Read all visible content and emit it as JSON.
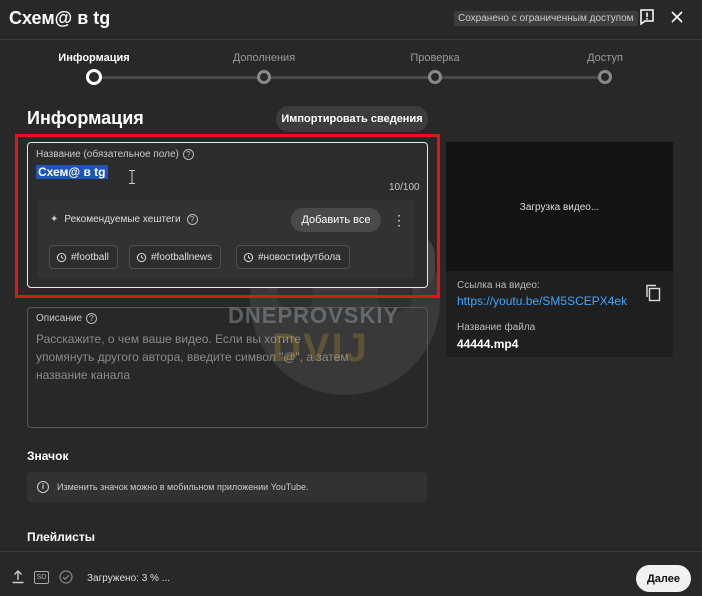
{
  "header": {
    "title": "Схем@ в tg",
    "saved_badge": "Сохранено с ограниченным доступом",
    "feedback_icon": "feedback-icon",
    "close_icon": "close-icon"
  },
  "steps": [
    {
      "label": "Информация",
      "active": true
    },
    {
      "label": "Дополнения",
      "active": false
    },
    {
      "label": "Проверка",
      "active": false
    },
    {
      "label": "Доступ",
      "active": false
    }
  ],
  "section": {
    "title": "Информация",
    "import_button": "Импортировать сведения"
  },
  "title_field": {
    "label": "Название (обязательное поле)",
    "value": "Схем@ в tg",
    "char_count": "10/100"
  },
  "hashtags": {
    "label": "Рекомендуемые хештеги",
    "add_all": "Добавить все",
    "tags": [
      "#football",
      "#footballnews",
      "#новостифутбола"
    ]
  },
  "watermark": {
    "line1": "DNEPROVSKIY",
    "line2": "DVIJ"
  },
  "description": {
    "label": "Описание",
    "placeholder": "Расскажите, о чем ваше видео. Если вы хотите упомянуть другого автора, введите символ \"@\", а затем название канала"
  },
  "preview": {
    "loading": "Загрузка видео...",
    "link_label": "Ссылка на видео:",
    "link": "https://youtu.be/SM5SCEPX4ek",
    "filename_label": "Название файла",
    "filename": "44444.mp4"
  },
  "thumbnail": {
    "title": "Значок",
    "note": "Изменить значок можно в мобильном приложении YouTube."
  },
  "playlists": {
    "title": "Плейлисты"
  },
  "footer": {
    "hd_badge": "SD",
    "status": "Загружено: 3 % ...",
    "next_button": "Далее"
  },
  "colors": {
    "background": "#282828",
    "highlight": "#e0141b",
    "link": "#3ea6ff",
    "selection": "#1f54b8"
  }
}
